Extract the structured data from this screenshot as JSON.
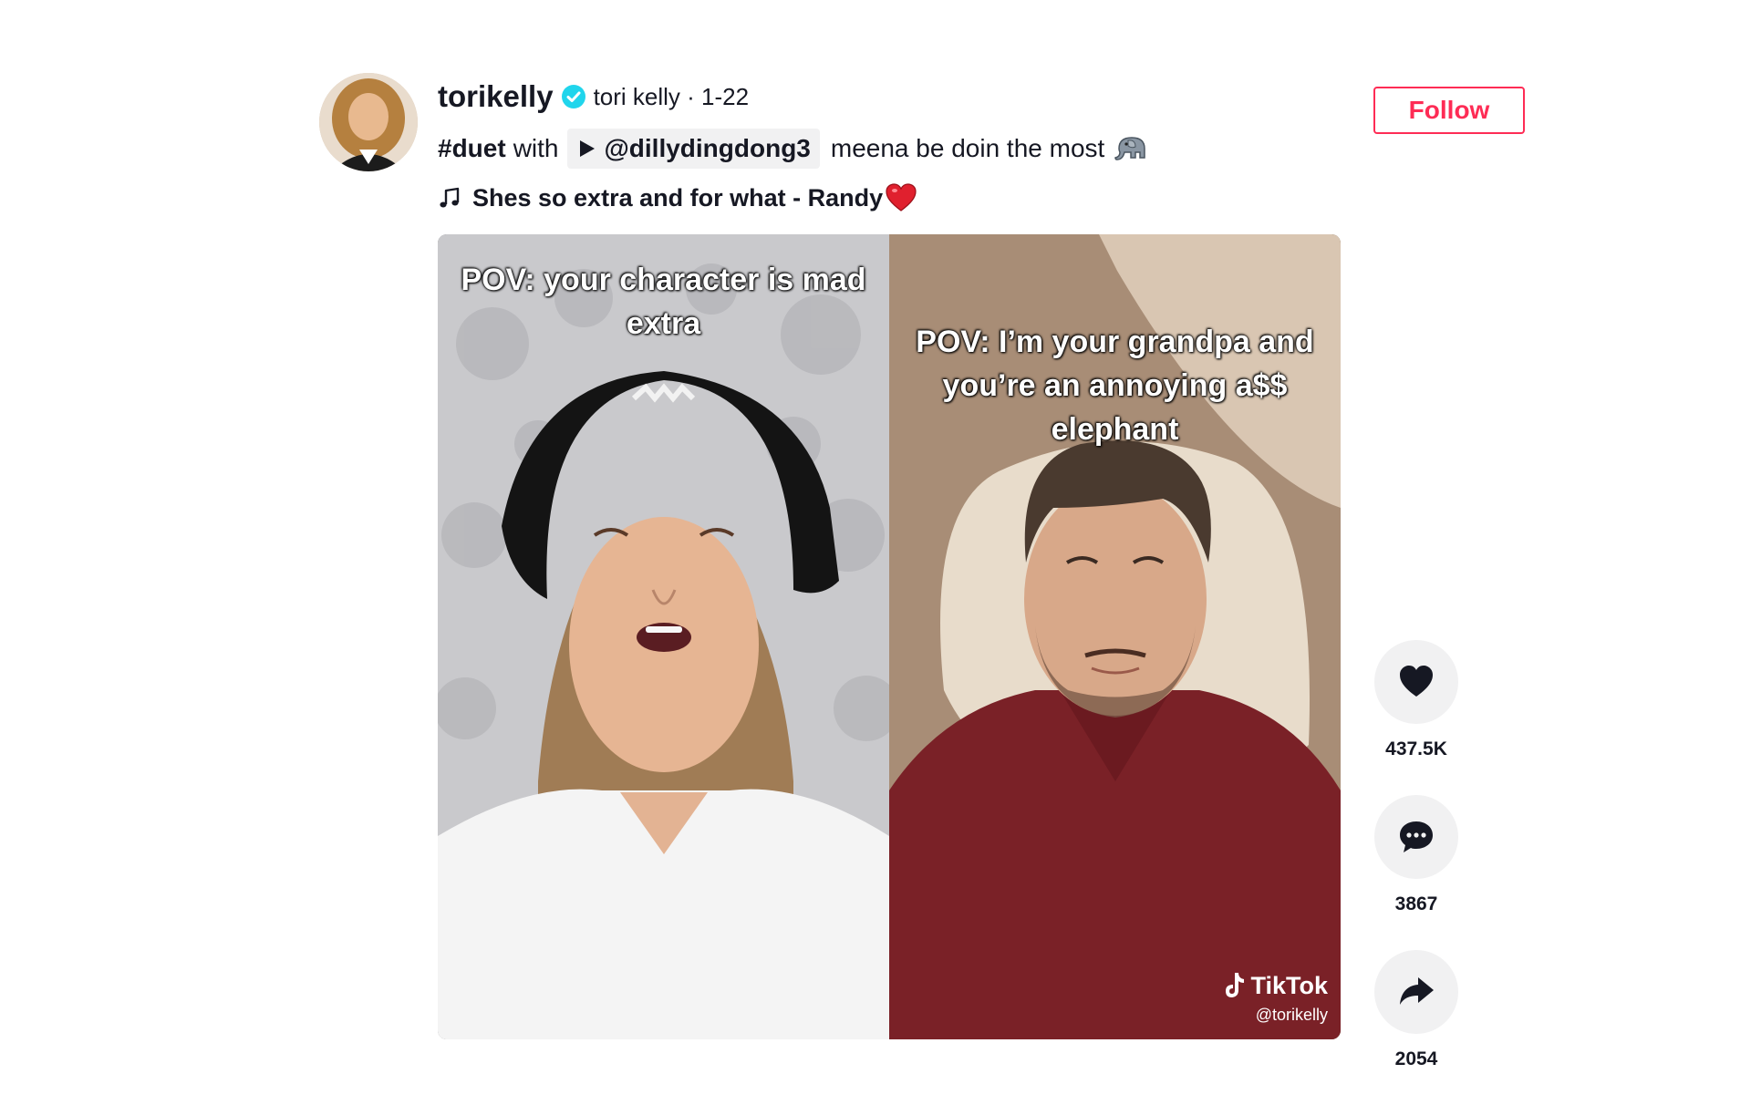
{
  "post": {
    "username": "torikelly",
    "nickname": "tori kelly · 1-22",
    "hashtag": "#duet",
    "with_text": "with",
    "mention": "@dillydingdong3",
    "description": "meena be doin the most",
    "music": "Shes so extra and for what - Randy",
    "follow_label": "Follow"
  },
  "video": {
    "left_caption": "POV: your character is mad extra",
    "right_caption": "POV: I’m your grandpa and you’re an annoying a$$ elephant",
    "watermark_logo": "TikTok",
    "watermark_user": "@torikelly"
  },
  "actions": [
    {
      "icon": "heart-icon",
      "count": "437.5K"
    },
    {
      "icon": "comment-icon",
      "count": "3867"
    },
    {
      "icon": "share-icon",
      "count": "2054"
    }
  ],
  "colors": {
    "accent": "#fe2c55",
    "verified": "#20d5ec",
    "text": "#161823",
    "button_bg": "#f1f1f2"
  }
}
